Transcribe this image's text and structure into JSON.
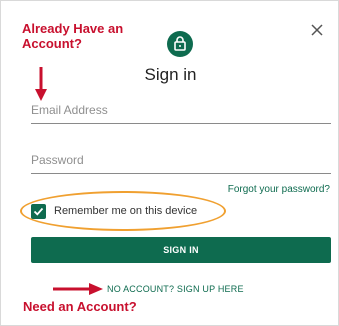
{
  "annotations": {
    "top": "Already Have an Account?",
    "bottom": "Need an Account?"
  },
  "dialog": {
    "title": "Sign in",
    "lock_icon": "lock-icon",
    "close_icon": "close-icon",
    "close_label": "×"
  },
  "form": {
    "email_placeholder": "Email Address",
    "password_placeholder": "Password",
    "forgot_link": "Forgot your password?",
    "remember_label": "Remember me on this device",
    "remember_checked": true,
    "signin_button": "SIGN IN",
    "signup_link": "NO ACCOUNT? SIGN UP HERE"
  },
  "colors": {
    "brand_green": "#0e6b4f",
    "annotation_red": "#c8102e",
    "highlight_orange": "#f0a030"
  }
}
